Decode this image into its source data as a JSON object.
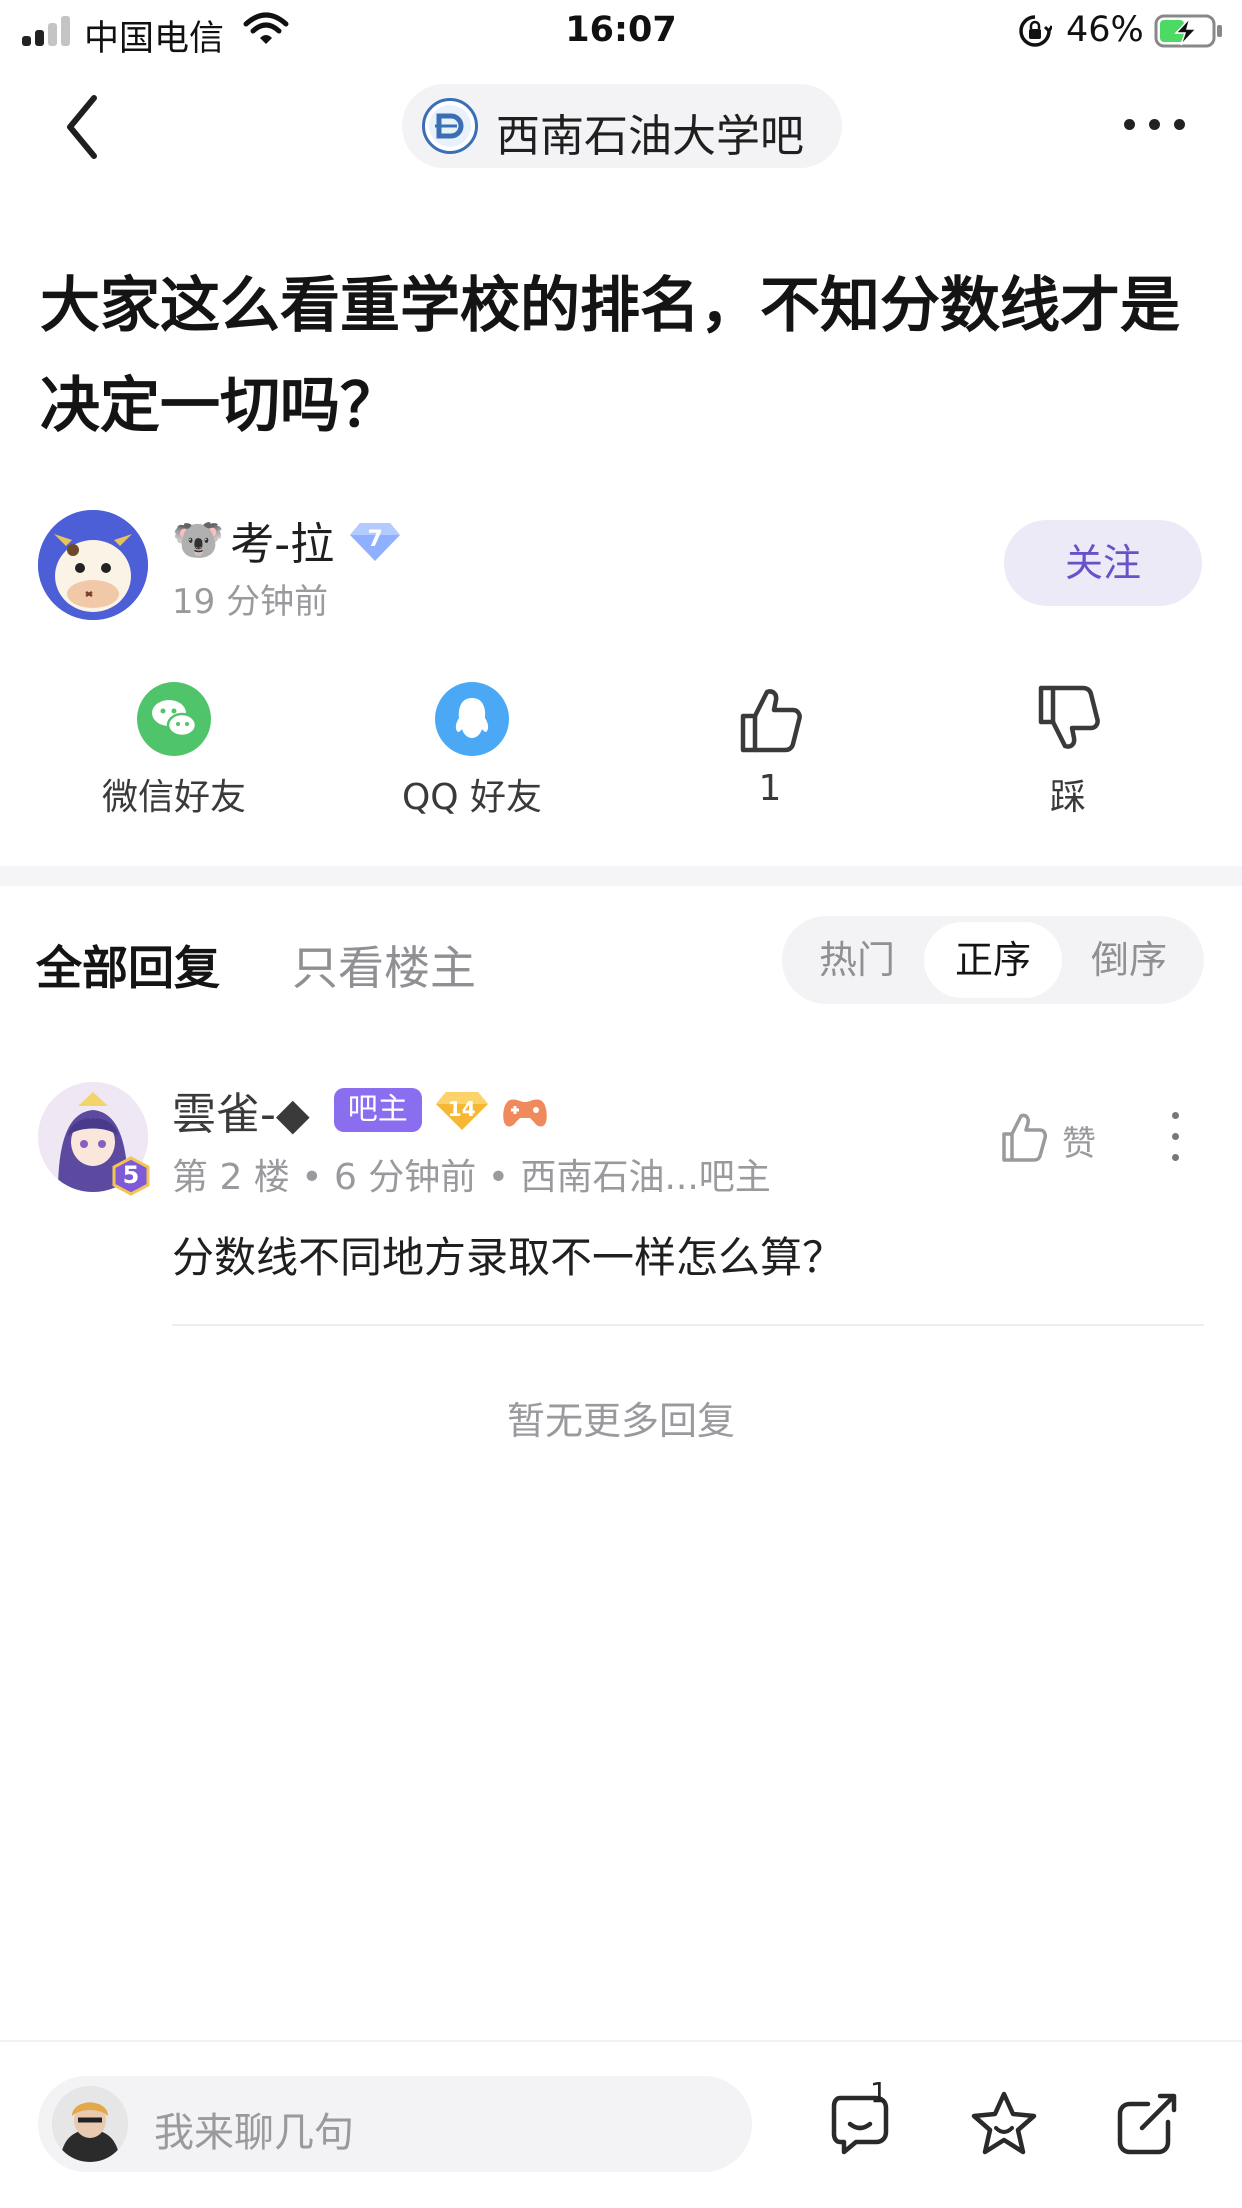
{
  "status_bar": {
    "carrier": "中国电信",
    "time": "16:07",
    "battery_percent": "46%",
    "signal_bars": 2,
    "battery_level": 0.46,
    "icons": [
      "signal-icon",
      "wifi-icon",
      "orientation-lock-icon",
      "battery-charging-icon"
    ]
  },
  "nav": {
    "forum_name": "西南石油大学吧",
    "icons": [
      "back-icon",
      "forum-logo",
      "more-icon"
    ]
  },
  "post": {
    "title": "大家这么看重学校的排名，不知分数线才是决定一切吗？",
    "author": {
      "emoji": "🐨",
      "name": "考-拉",
      "level": "7",
      "time": "19 分钟前",
      "follow_label": "关注"
    },
    "actions": [
      {
        "name": "wechat",
        "label": "微信好友",
        "icon": "wechat-icon",
        "color": "#4fc46b"
      },
      {
        "name": "qq",
        "label": "QQ 好友",
        "icon": "qq-icon",
        "color": "#4aa8f5"
      },
      {
        "name": "like",
        "label": "1",
        "icon": "thumbs-up-icon"
      },
      {
        "name": "dislike",
        "label": "踩",
        "icon": "thumbs-down-icon"
      }
    ]
  },
  "replies_header": {
    "tab_all": "全部回复",
    "tab_op_only": "只看楼主",
    "sort_options": [
      "热门",
      "正序",
      "倒序"
    ],
    "sort_selected": "正序"
  },
  "replies": [
    {
      "name": "雲雀-◆",
      "owner_badge": "吧主",
      "level_badge": "14",
      "avatar_level": "5",
      "floor": "第 2 楼",
      "time": "6 分钟前",
      "forum_role": "西南石油...吧主",
      "like_label": "赞",
      "text": "分数线不同地方录取不一样怎么算？"
    }
  ],
  "no_more_text": "暂无更多回复",
  "bottom_bar": {
    "placeholder": "我来聊几句",
    "comment_count": "1",
    "icons": [
      "comment-icon",
      "star-icon",
      "share-icon"
    ]
  },
  "colors": {
    "accent": "#6a51c9",
    "follow_bg": "#eceaf7",
    "owner_badge": "#8b6df0",
    "muted_text": "#9a9a9e"
  }
}
